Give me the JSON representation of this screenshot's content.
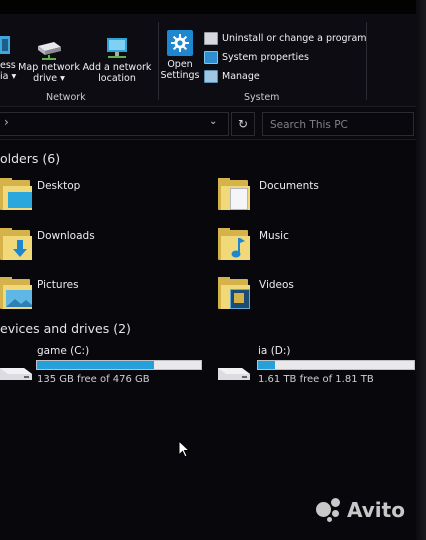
{
  "ribbon": {
    "network_group_label": "Network",
    "system_group_label": "System",
    "access_media": {
      "line1": "ess",
      "line2": "ia ▾",
      "icon": "media-icon"
    },
    "map_network_drive": {
      "line1": "Map network",
      "line2": "drive ▾",
      "icon": "network-drive-icon"
    },
    "add_network_location": {
      "line1": "Add a network",
      "line2": "location",
      "icon": "network-location-icon"
    },
    "open_settings": {
      "line1": "Open",
      "line2": "Settings",
      "icon": "gear-icon"
    },
    "uninstall": {
      "label": "Uninstall or change a program",
      "icon": "uninstall-icon"
    },
    "system_properties": {
      "label": "System properties",
      "icon": "system-properties-icon"
    },
    "manage": {
      "label": "Manage",
      "icon": "manage-icon"
    }
  },
  "address_bar": {
    "chevron": "›",
    "dropdown": "⌄",
    "refresh": "↻",
    "search_placeholder": "Search This PC"
  },
  "folders_section": {
    "title": "olders (6)",
    "items": [
      {
        "label": "Desktop",
        "icon": "desktop-folder-icon"
      },
      {
        "label": "Documents",
        "icon": "documents-folder-icon"
      },
      {
        "label": "Downloads",
        "icon": "downloads-folder-icon"
      },
      {
        "label": "Music",
        "icon": "music-folder-icon"
      },
      {
        "label": "Pictures",
        "icon": "pictures-folder-icon"
      },
      {
        "label": "Videos",
        "icon": "videos-folder-icon"
      }
    ]
  },
  "drives_section": {
    "title": "evices and drives (2)",
    "drives": [
      {
        "name": "game (C:)",
        "free_text": "135 GB free of 476 GB",
        "used_fraction": 0.716,
        "icon": "hard-drive-icon"
      },
      {
        "name": "ia (D:)",
        "free_text": "1.61 TB free of 1.81 TB",
        "used_fraction": 0.11,
        "icon": "hard-drive-icon"
      }
    ]
  },
  "watermark": {
    "text": "Avito"
  },
  "colors": {
    "accent": "#26a0da",
    "folder": "#f1d879",
    "background": "#08070b"
  }
}
